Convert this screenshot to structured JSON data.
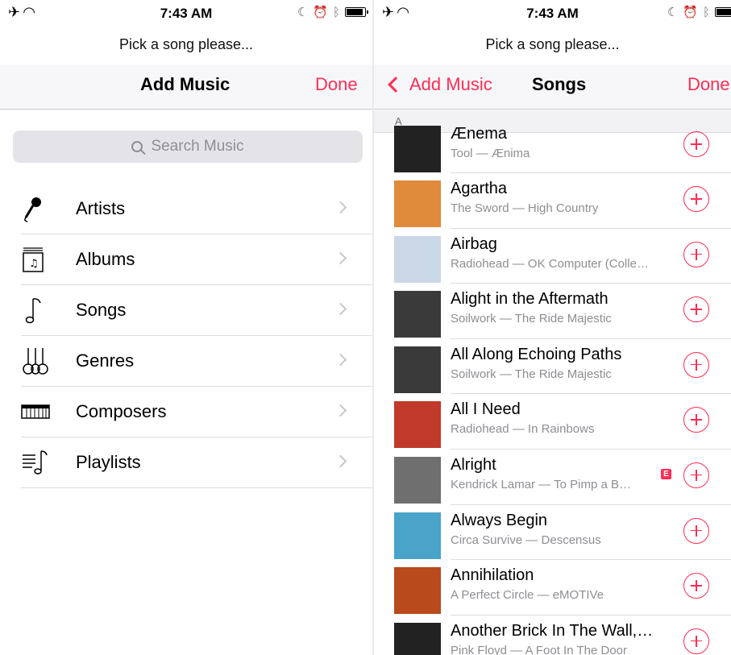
{
  "status_bar": {
    "time": "7:43 AM"
  },
  "prompt": "Pick a song please...",
  "left": {
    "title": "Add Music",
    "done": "Done",
    "search_placeholder": "Search Music",
    "menu": [
      {
        "label": "Artists",
        "icon": "microphone-icon"
      },
      {
        "label": "Albums",
        "icon": "album-icon"
      },
      {
        "label": "Songs",
        "icon": "music-note-icon"
      },
      {
        "label": "Genres",
        "icon": "guitars-icon"
      },
      {
        "label": "Composers",
        "icon": "piano-icon"
      },
      {
        "label": "Playlists",
        "icon": "playlist-icon"
      }
    ]
  },
  "right": {
    "back": "Add Music",
    "title": "Songs",
    "done": "Done",
    "section": "A",
    "songs": [
      {
        "title": "Ænema",
        "subtitle": "Tool — Ænima",
        "art_color": "#222222",
        "explicit": false
      },
      {
        "title": "Agartha",
        "subtitle": "The Sword — High Country",
        "art_color": "#e08a3c",
        "explicit": false
      },
      {
        "title": "Airbag",
        "subtitle": "Radiohead — OK Computer (Colle…",
        "art_color": "#c9d7e6",
        "explicit": false
      },
      {
        "title": "Alight in the Aftermath",
        "subtitle": "Soilwork — The Ride Majestic",
        "art_color": "#3a3a3a",
        "explicit": false
      },
      {
        "title": "All Along Echoing Paths",
        "subtitle": "Soilwork — The Ride Majestic",
        "art_color": "#3a3a3a",
        "explicit": false
      },
      {
        "title": "All I Need",
        "subtitle": "Radiohead — In Rainbows",
        "art_color": "#c0392b",
        "explicit": false
      },
      {
        "title": "Alright",
        "subtitle": "Kendrick Lamar — To Pimp a B…",
        "art_color": "#6f6f6f",
        "explicit": true,
        "explicit_label": "E"
      },
      {
        "title": "Always Begin",
        "subtitle": "Circa Survive — Descensus",
        "art_color": "#4aa3c8",
        "explicit": false
      },
      {
        "title": "Annihilation",
        "subtitle": "A Perfect Circle — eMOTIVe",
        "art_color": "#b84a1c",
        "explicit": false
      },
      {
        "title": "Another Brick In The Wall,…",
        "subtitle": "Pink Floyd — A Foot In The Door",
        "art_color": "#222222",
        "explicit": false
      }
    ]
  },
  "colors": {
    "accent": "#ff2d55",
    "secondary_text": "#8e8e93",
    "separator": "#dcdce0"
  }
}
